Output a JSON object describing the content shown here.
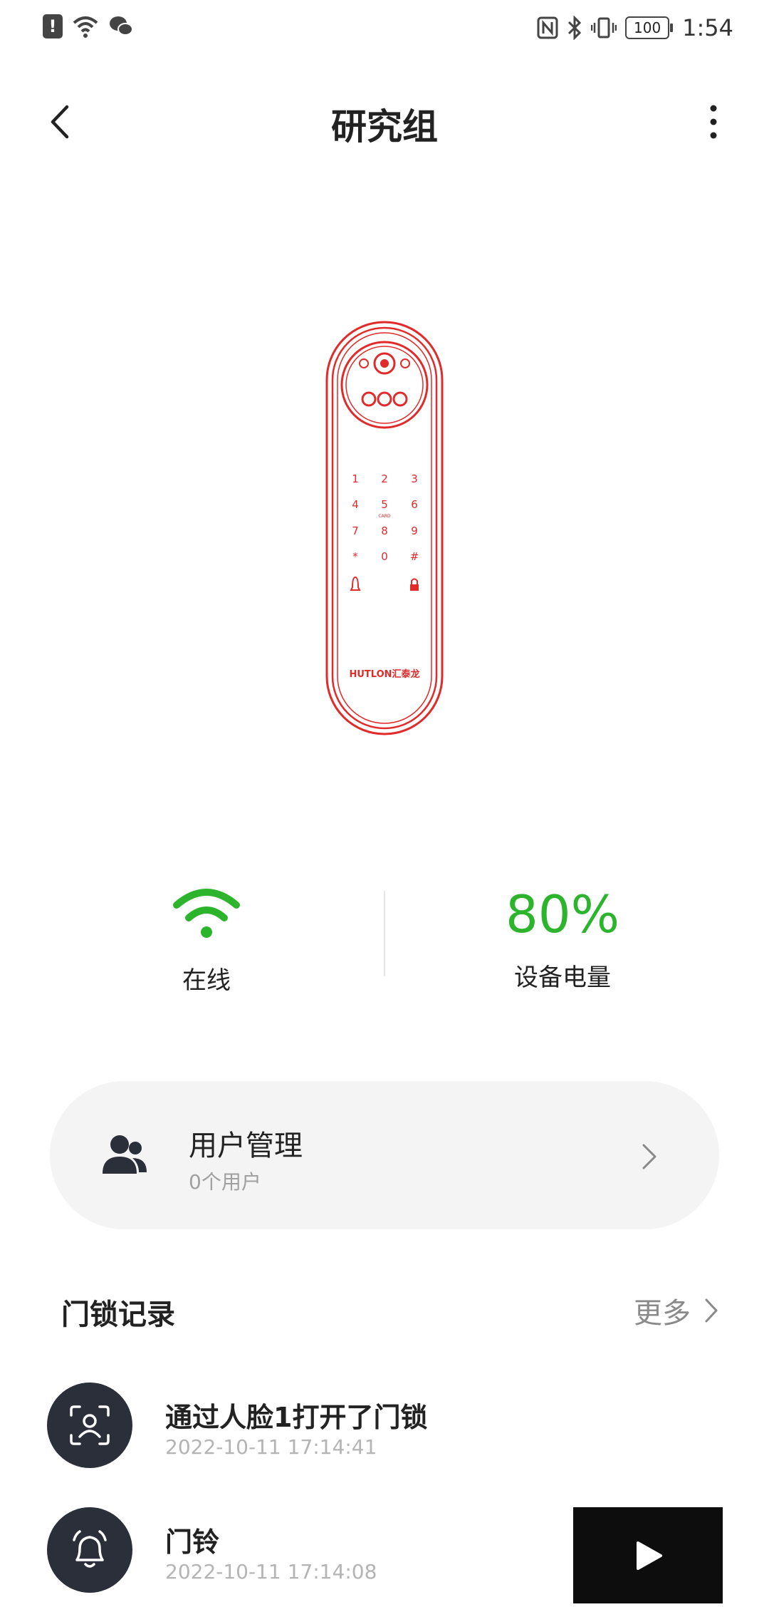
{
  "status_bar": {
    "battery_level": "100",
    "time": "1:54"
  },
  "header": {
    "title": "研究组"
  },
  "lock_image": {
    "brand_text": "HUTLON汇泰龙",
    "keys": [
      "1",
      "2",
      "3",
      "4",
      "5",
      "6",
      "7",
      "8",
      "9",
      "*",
      "0",
      "#"
    ],
    "card_label": "CARD"
  },
  "device_status": {
    "online_label": "在线",
    "battery_value": "80%",
    "battery_label": "设备电量",
    "accent_color": "#2cb52c"
  },
  "user_management": {
    "title": "用户管理",
    "subtitle": "0个用户"
  },
  "records": {
    "title": "门锁记录",
    "more_label": "更多",
    "items": [
      {
        "title": "通过人脸1打开了门锁",
        "time": "2022-10-11 17:14:41",
        "icon": "face-scan-icon"
      },
      {
        "title": "门铃",
        "time": "2022-10-11 17:14:08",
        "icon": "bell-icon"
      }
    ]
  }
}
